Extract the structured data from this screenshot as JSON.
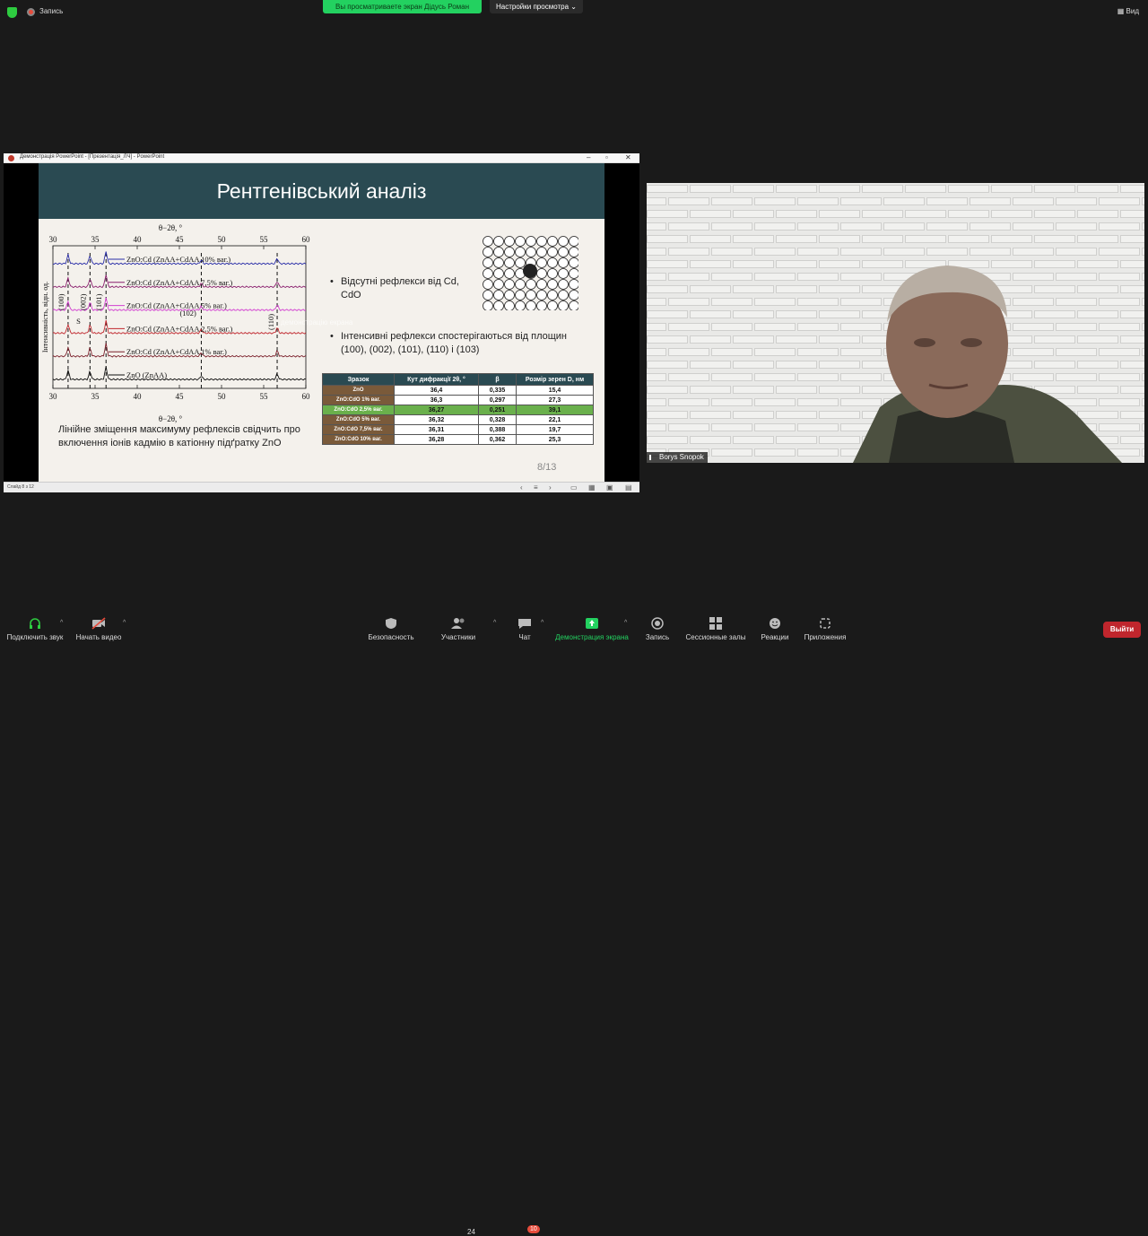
{
  "topbar": {
    "record_label": "Запись",
    "share_banner": "Вы просматриваете экран Дідусь Роман",
    "view_settings": "Настройки просмотра",
    "view_button": "Вид"
  },
  "ppt": {
    "window_title": "Демонстрація PowerPoint - [Презентація_ЛЧ] - PowerPoint",
    "status_text": "Слайд 8 з 12",
    "slide": {
      "title": "Рентгенівський аналіз",
      "bullets": [
        "Відсутні рефлекси від Cd, CdO",
        "Інтенсивні рефлекси спостерігаються від площин (100), (002), (101), (110) і (103)"
      ],
      "note": "Лінійне зміщення максимуму рефлексів свідчить про включення іонів кадмію в катіонну підґратку ZnO",
      "slide_number": "8/13",
      "overlay_text": "демонстрацію екрана",
      "table": {
        "headers": [
          "Зразок",
          "Кут дифракції 2θ, °",
          "β",
          "Розмір зерен D, нм"
        ],
        "rows": [
          [
            "ZnO",
            "36,4",
            "0,335",
            "15,4"
          ],
          [
            "ZnO:CdO 1% ваг.",
            "36,3",
            "0,297",
            "27,3"
          ],
          [
            "ZnO:CdO 2,5% ваг.",
            "36,27",
            "0,251",
            "39,1"
          ],
          [
            "ZnO:CdO 5% ваг.",
            "36,32",
            "0,328",
            "22,1"
          ],
          [
            "ZnO:CdO 7,5% ваг.",
            "36,31",
            "0,388",
            "19,7"
          ],
          [
            "ZnO:CdO 10% ваг.",
            "36,28",
            "0,362",
            "25,3"
          ]
        ]
      }
    }
  },
  "chart_data": {
    "type": "line",
    "title": "",
    "xlabel": "θ−2θ, °",
    "ylabel": "Інтенсивність, відн. од.",
    "xlim": [
      30,
      60
    ],
    "x_ticks": [
      "30",
      "35",
      "40",
      "45",
      "50",
      "55",
      "60"
    ],
    "peaks": [
      {
        "x": 31.8,
        "label": "(100)"
      },
      {
        "x": 34.4,
        "label": "(002)"
      },
      {
        "x": 36.3,
        "label": "(101)"
      },
      {
        "x": 47.6,
        "label": "(102)"
      },
      {
        "x": 56.6,
        "label": "(110)"
      }
    ],
    "peak_symbol_label": "S",
    "series": [
      {
        "name": "ZnO:Cd (ZnAA+CdAA 10% ваг.)",
        "color": "#2b2fa8"
      },
      {
        "name": "ZnO:Cd (ZnAA+CdAA 7,5% ваг.)",
        "color": "#8a1f6e"
      },
      {
        "name": "ZnO:Cd (ZnAA+CdAA 5% ваг.)",
        "color": "#d23fd0"
      },
      {
        "name": "ZnO:Cd (ZnAA+CdAA 2,5% ваг.)",
        "color": "#c0262d"
      },
      {
        "name": "ZnO:Cd (ZnAA+CdAA 1% ваг.)",
        "color": "#7a1f2a"
      },
      {
        "name": "ZnO (ZnAA)",
        "color": "#111111"
      }
    ]
  },
  "video": {
    "participant_name": "Borys Snopok"
  },
  "toolbar": {
    "items": [
      {
        "label": "Подключить звук"
      },
      {
        "label": "Начать видео"
      },
      {
        "label": "Безопасность"
      },
      {
        "label": "Участники",
        "count": "24"
      },
      {
        "label": "Чат",
        "count": "10"
      },
      {
        "label": "Демонстрация экрана"
      },
      {
        "label": "Запись"
      },
      {
        "label": "Сессионные залы"
      },
      {
        "label": "Реакции"
      },
      {
        "label": "Приложения"
      }
    ],
    "leave": "Выйти"
  }
}
